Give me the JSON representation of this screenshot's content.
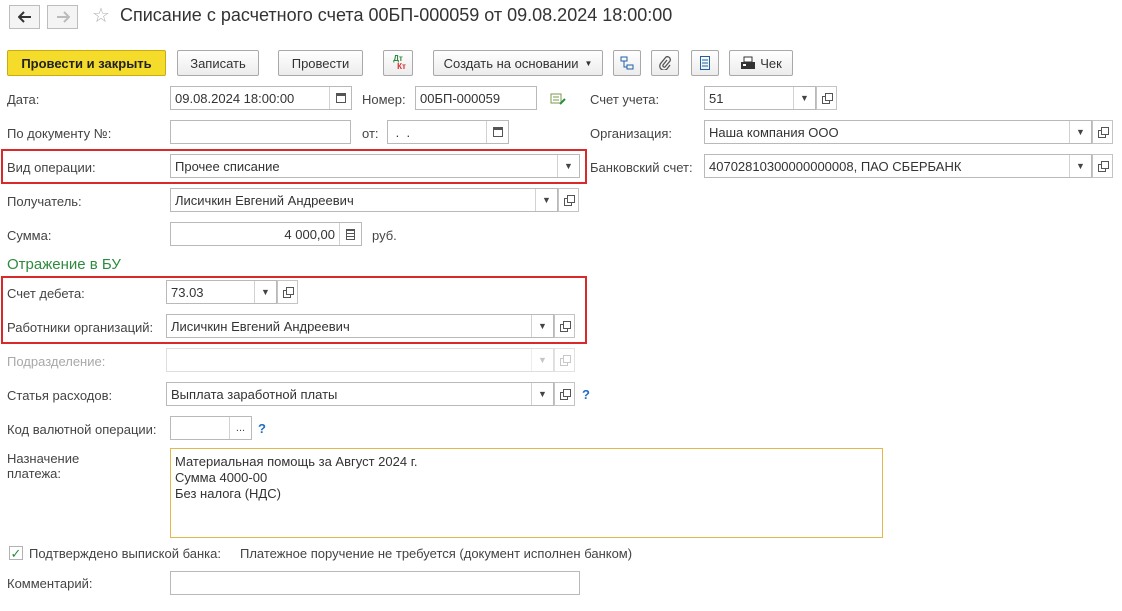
{
  "window": {
    "title": "Списание с расчетного счета 00БП-000059 от 09.08.2024 18:00:00"
  },
  "toolbar": {
    "post_and_close": "Провести и закрыть",
    "save": "Записать",
    "post": "Провести",
    "dt_kt_top": "Дт",
    "dt_kt_bottom": "Кт",
    "create_based_on": "Создать на основании",
    "receipt": "Чек"
  },
  "form": {
    "date": {
      "label": "Дата:",
      "value": "09.08.2024 18:00:00"
    },
    "number": {
      "label": "Номер:",
      "value": "00БП-000059"
    },
    "account": {
      "label": "Счет учета:",
      "value": "51"
    },
    "doc_no": {
      "label": "По документу №:",
      "value": ""
    },
    "doc_from": {
      "label": "от:",
      "value": " .  ."
    },
    "organization": {
      "label": "Организация:",
      "value": "Наша компания ООО"
    },
    "operation_type": {
      "label": "Вид операции:",
      "value": "Прочее списание"
    },
    "bank_account": {
      "label": "Банковский счет:",
      "value": "40702810300000000008, ПАО СБЕРБАНК"
    },
    "recipient": {
      "label": "Получатель:",
      "value": "Лисичкин Евгений Андреевич"
    },
    "amount": {
      "label": "Сумма:",
      "value": "4 000,00",
      "currency": "руб."
    }
  },
  "accounting": {
    "section_title": "Отражение в БУ",
    "debit_account": {
      "label": "Счет дебета:",
      "value": "73.03"
    },
    "employees": {
      "label": "Работники организаций:",
      "value": "Лисичкин Евгений Андреевич"
    },
    "department": {
      "label": "Подразделение:",
      "value": ""
    },
    "expense_item": {
      "label": "Статья расходов:",
      "value": "Выплата заработной платы"
    },
    "currency_op_code": {
      "label": "Код валютной операции:",
      "value": ""
    }
  },
  "payment": {
    "label_line1": "Назначение",
    "label_line2": "платежа:",
    "lines": [
      "Материальная помощь за Август 2024 г.",
      "Сумма 4000-00",
      "Без налога (НДС)"
    ]
  },
  "confirmation": {
    "checked": true,
    "label": "Подтверждено выпиской банка:",
    "status": "Платежное поручение не требуется (документ исполнен банком)"
  },
  "comment": {
    "label": "Комментарий:",
    "value": ""
  },
  "help_mark": "?"
}
